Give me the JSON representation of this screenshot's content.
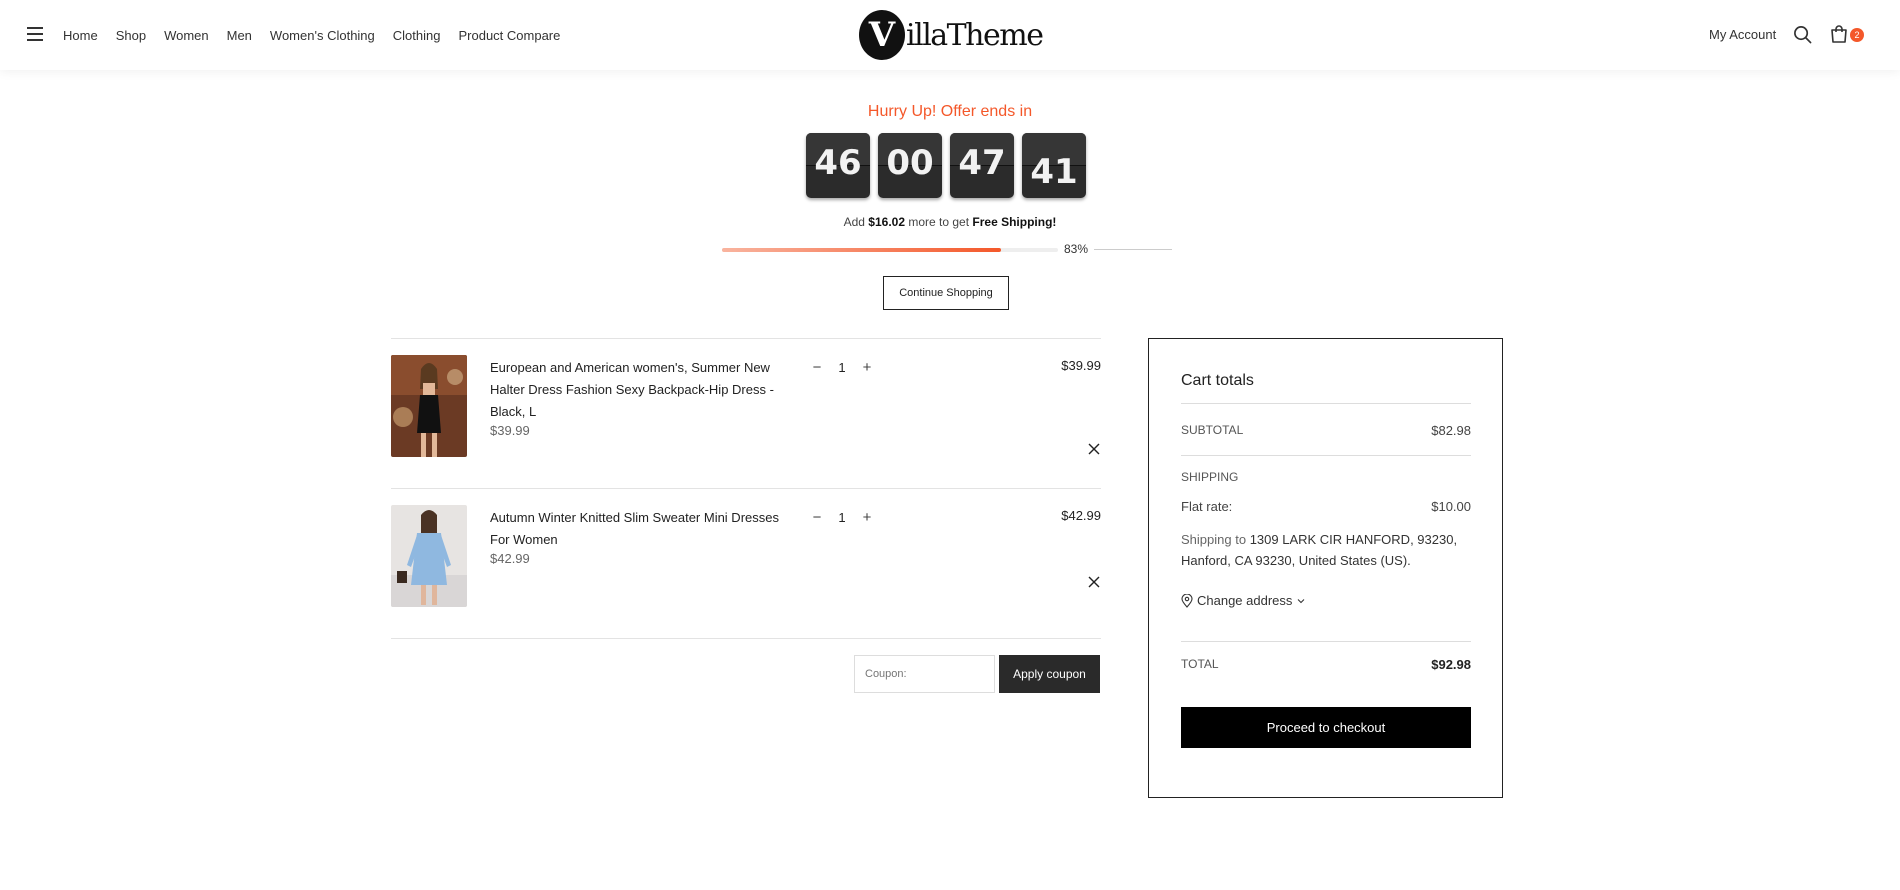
{
  "header": {
    "nav": [
      "Home",
      "Shop",
      "Women",
      "Men",
      "Women's Clothing",
      "Clothing",
      "Product Compare"
    ],
    "logo_letter": "V",
    "logo_text": "illaTheme",
    "account_label": "My Account",
    "cart_count": "2",
    "icons": [
      "hamburger-menu-icon",
      "search-icon",
      "shopping-bag-icon"
    ]
  },
  "offer": {
    "headline": "Hurry Up! Offer ends in",
    "countdown": [
      "46",
      "00",
      "47",
      "41"
    ]
  },
  "free_shipping": {
    "prefix": "Add",
    "amount": "$16.02",
    "middle": "more to get",
    "goal": "Free Shipping!",
    "progress_percent": 83,
    "progress_label": "83%"
  },
  "continue_label": "Continue Shopping",
  "cart": {
    "items": [
      {
        "name": "European and American women's, Summer New Halter Dress Fashion Sexy Backpack-Hip Dress - Black, L",
        "unit_price": "$39.99",
        "quantity": "1",
        "total": "$39.99"
      },
      {
        "name": "Autumn Winter Knitted Slim Sweater Mini Dresses For Women",
        "unit_price": "$42.99",
        "quantity": "1",
        "total": "$42.99"
      }
    ],
    "qty_minus": "−",
    "qty_plus": "+"
  },
  "coupon": {
    "placeholder": "Coupon:",
    "button": "Apply coupon"
  },
  "totals": {
    "title": "Cart totals",
    "subtotal_label": "SUBTOTAL",
    "subtotal_value": "$82.98",
    "shipping_label": "SHIPPING",
    "flat_rate_label": "Flat rate:",
    "flat_rate_value": "$10.00",
    "shipping_to_prefix": "Shipping to",
    "shipping_to_address": "1309 LARK CIR HANFORD, 93230, Hanford, CA 93230, United States (US).",
    "change_address": "Change address",
    "total_label": "TOTAL",
    "total_value": "$92.98",
    "checkout": "Proceed to checkout"
  },
  "colors": {
    "accent": "#f4582a",
    "button_dark": "#2a2a2a"
  }
}
